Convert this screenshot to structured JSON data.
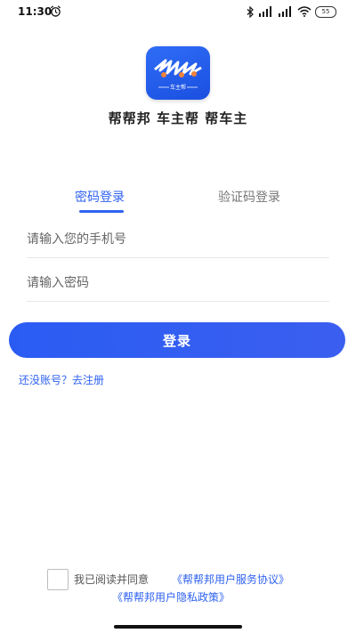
{
  "status_bar": {
    "time": "11:30",
    "battery": "55",
    "icons": [
      "alarm-icon",
      "bluetooth-icon",
      "signal-icon",
      "signal-icon",
      "wifi-icon",
      "battery-icon"
    ]
  },
  "logo": {
    "label": "车主帮",
    "colors": {
      "background": "#2f6df6",
      "accent": "#f0833a"
    }
  },
  "app": {
    "slogan": "帮帮邦 车主帮 帮车主"
  },
  "tabs": [
    {
      "label": "密码登录",
      "active": true
    },
    {
      "label": "验证码登录",
      "active": false
    }
  ],
  "form": {
    "phone_placeholder": "请输入您的手机号",
    "password_placeholder": "请输入密码"
  },
  "login_button": {
    "label": "登录"
  },
  "register_link": "还没账号？去注册",
  "agreement": {
    "prefix": "我已阅读并同意",
    "service": "《帮帮邦用户服务协议》",
    "privacy": "《帮帮邦用户隐私政策》",
    "checked": false
  },
  "colors": {
    "primary": "#2f62f0",
    "button": "#2a5cf3",
    "divider": "#e6e6e6",
    "muted_text": "#777777"
  }
}
